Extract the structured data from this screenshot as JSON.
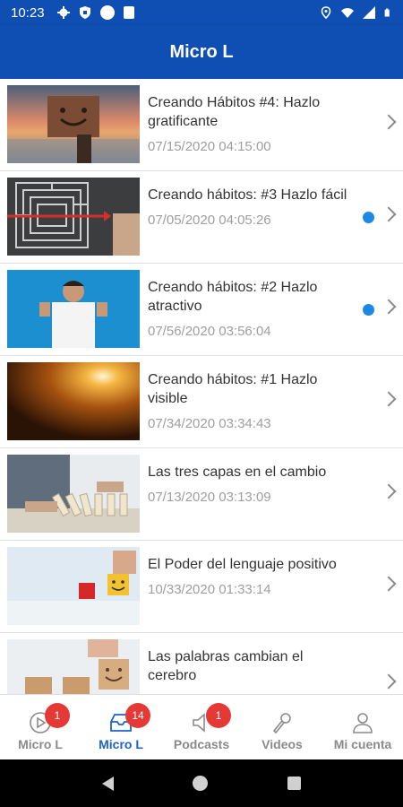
{
  "status_bar": {
    "time": "10:23",
    "left_icons": [
      "settings-icon",
      "shield-icon",
      "circle-icon",
      "sd-card-icon"
    ],
    "right_icons": [
      "location-icon",
      "wifi-icon",
      "signal-icon",
      "battery-icon"
    ]
  },
  "app_bar": {
    "title": "Micro L",
    "color": "#0f4eb3"
  },
  "items": [
    {
      "title": "Creando Hábitos #4: Hazlo gratificante",
      "date": "07/15/2020 04:15:00",
      "unread": false
    },
    {
      "title": "Creando hábitos: #3 Hazlo fácil",
      "date": "07/05/2020 04:05:26",
      "unread": true
    },
    {
      "title": "Creando hábitos: #2 Hazlo atractivo",
      "date": "07/56/2020 03:56:04",
      "unread": true
    },
    {
      "title": "Creando hábitos: #1 Hazlo visible",
      "date": "07/34/2020 03:34:43",
      "unread": false
    },
    {
      "title": "Las tres capas en el cambio",
      "date": "07/13/2020 03:13:09",
      "unread": false
    },
    {
      "title": "El Poder del lenguaje positivo",
      "date": "10/33/2020 01:33:14",
      "unread": false
    },
    {
      "title": "Las palabras cambian el cerebro",
      "date": "",
      "unread": false
    }
  ],
  "bottom_nav": [
    {
      "label": "Micro L",
      "icon": "play-circle-icon",
      "badge": "1",
      "active": false
    },
    {
      "label": "Micro L",
      "icon": "inbox-icon",
      "badge": "14",
      "active": true
    },
    {
      "label": "Podcasts",
      "icon": "speaker-icon",
      "badge": "1",
      "active": false
    },
    {
      "label": "Videos",
      "icon": "microphone-icon",
      "badge": "",
      "active": false
    },
    {
      "label": "Mi cuenta",
      "icon": "user-icon",
      "badge": "",
      "active": false
    }
  ],
  "colors": {
    "primary": "#0f4eb3",
    "active_tab": "#1e63c9",
    "badge": "#e53935",
    "unread_dot": "#1e88e5"
  }
}
